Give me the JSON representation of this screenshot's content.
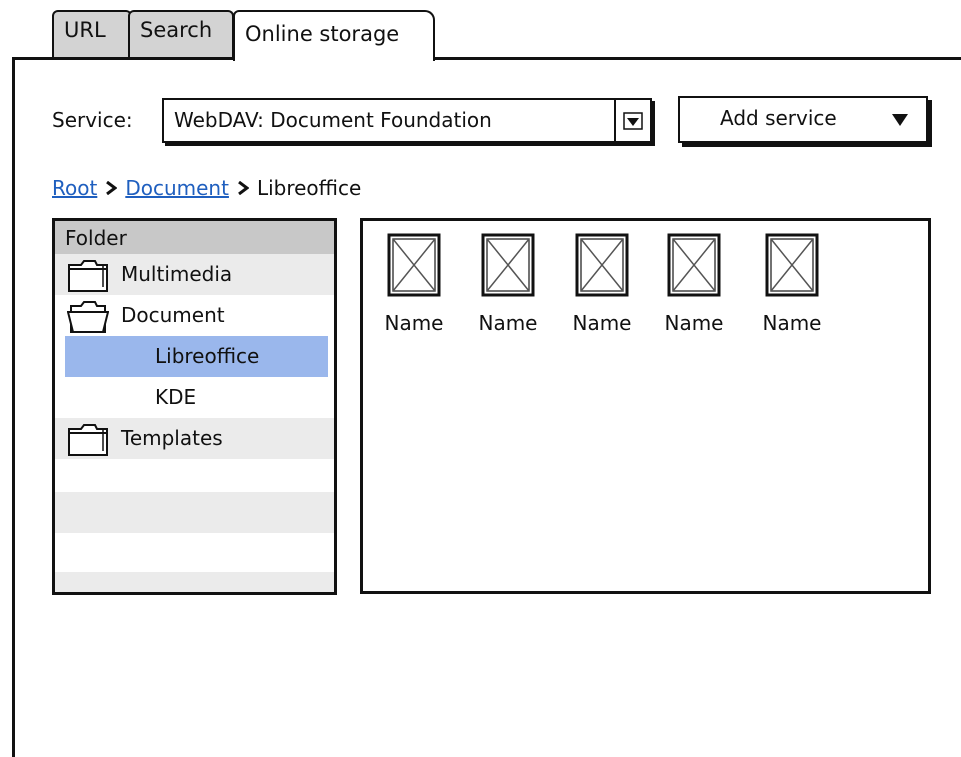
{
  "tabs": [
    {
      "label": "URL"
    },
    {
      "label": "Search"
    },
    {
      "label": "Online storage"
    }
  ],
  "service": {
    "label": "Service:",
    "selected": "WebDAV: Document Foundation"
  },
  "add_service": {
    "label": "Add service"
  },
  "breadcrumb": {
    "root": "Root",
    "document": "Document",
    "current": "Libreoffice"
  },
  "tree": {
    "header": "Folder",
    "items": [
      {
        "label": "Multimedia",
        "icon": "closed-folder-icon"
      },
      {
        "label": "Document",
        "icon": "open-folder-icon"
      },
      {
        "label": "Libreoffice"
      },
      {
        "label": "KDE"
      },
      {
        "label": "Templates",
        "icon": "closed-folder-icon"
      }
    ]
  },
  "files": [
    {
      "name": "Name"
    },
    {
      "name": "Name"
    },
    {
      "name": "Name"
    },
    {
      "name": "Name"
    },
    {
      "name": "Name"
    }
  ],
  "colors": {
    "selection": "#9ab7ec",
    "link": "#1f5fbf",
    "tab_inactive": "#d3d3d3",
    "tree_header": "#c8c8c8"
  }
}
